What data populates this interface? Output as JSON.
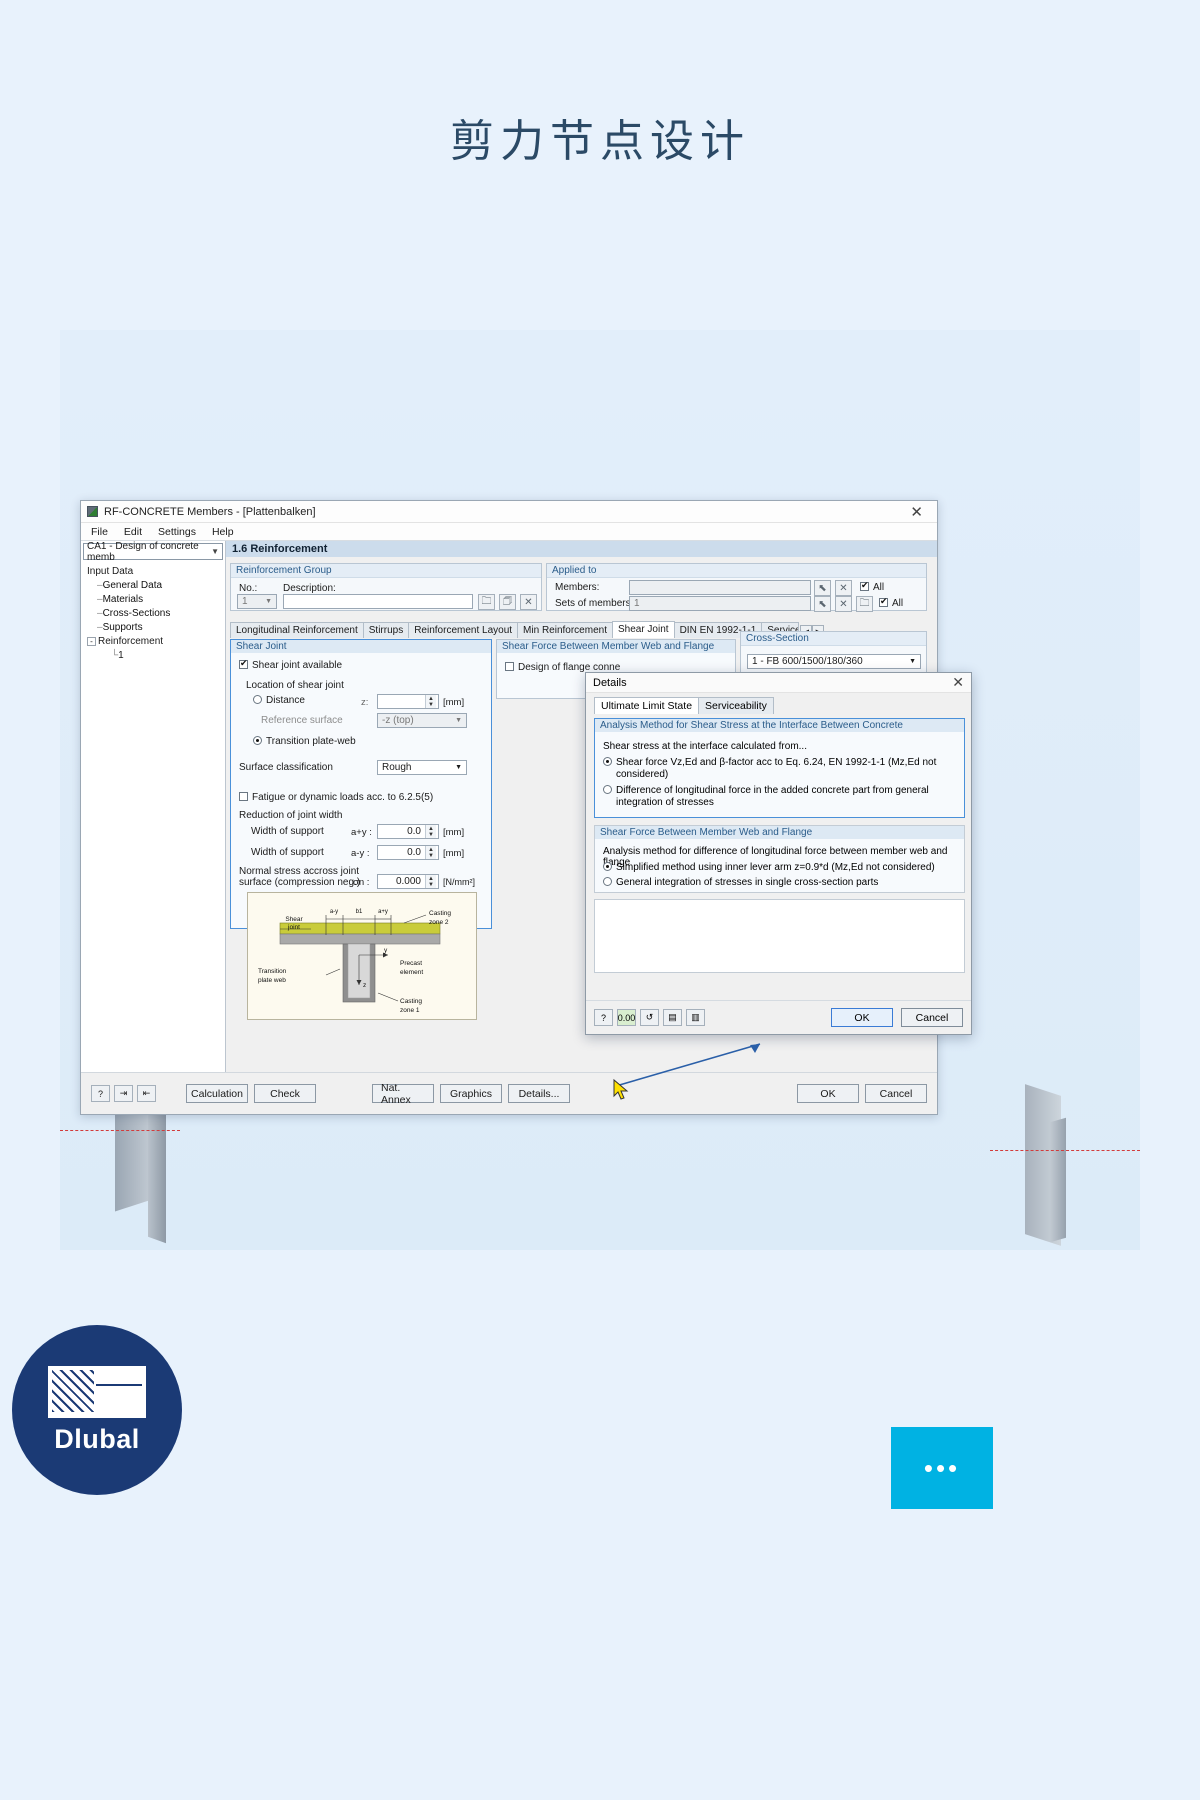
{
  "page": {
    "title": "剪力节点设计"
  },
  "window": {
    "title": "RF-CONCRETE Members - [Plattenbalken]",
    "close": "✕",
    "menu": [
      "File",
      "Edit",
      "Settings",
      "Help"
    ],
    "case_combo": "CA1 - Design of concrete memb",
    "tree": [
      {
        "label": "Input Data",
        "level": 1
      },
      {
        "label": "General Data",
        "level": 2
      },
      {
        "label": "Materials",
        "level": 2
      },
      {
        "label": "Cross-Sections",
        "level": 2
      },
      {
        "label": "Supports",
        "level": 2
      },
      {
        "label": "Reinforcement",
        "level": 2,
        "expander": "-"
      },
      {
        "label": "1",
        "level": 3
      }
    ],
    "section_header": "1.6 Reinforcement",
    "reinforcement_group": {
      "title": "Reinforcement Group",
      "no_label": "No.:",
      "no_value": "1",
      "description_label": "Description:",
      "description_value": ""
    },
    "applied_to": {
      "title": "Applied to",
      "members_label": "Members:",
      "members_value": "",
      "sets_label": "Sets of members:",
      "sets_value": "1",
      "all_label": "All"
    },
    "tabs": [
      {
        "label": "Longitudinal Reinforcement",
        "active": false
      },
      {
        "label": "Stirrups",
        "active": false
      },
      {
        "label": "Reinforcement Layout",
        "active": false
      },
      {
        "label": "Min Reinforcement",
        "active": false
      },
      {
        "label": "Shear Joint",
        "active": true
      },
      {
        "label": "DIN EN 1992-1-1",
        "active": false
      },
      {
        "label": "Service",
        "active": false
      }
    ],
    "tab_nav": {
      "prev": "◀",
      "next": "▶"
    },
    "shear_joint": {
      "title": "Shear Joint",
      "available_label": "Shear joint available",
      "available_checked": true,
      "location_label": "Location of shear joint",
      "distance_label": "Distance",
      "distance_selected": false,
      "z_label": "z:",
      "z_value": "",
      "z_unit": "[mm]",
      "reference_surface_label": "Reference surface",
      "reference_surface_value": "-z (top)",
      "transition_label": "Transition plate-web",
      "transition_selected": true,
      "surface_class_label": "Surface classification",
      "surface_class_value": "Rough",
      "fatigue_label": "Fatigue or dynamic loads acc. to 6.2.5(5)",
      "fatigue_checked": false,
      "reduction_label": "Reduction of joint width",
      "width_pos_label": "Width of support",
      "width_pos_symbol": "a+y :",
      "width_pos_value": "0.0",
      "width_pos_unit": "[mm]",
      "width_neg_label": "Width of support",
      "width_neg_symbol": "a-y :",
      "width_neg_value": "0.0",
      "width_neg_unit": "[mm]",
      "normal_stress_label_1": "Normal stress accross joint",
      "normal_stress_label_2": "surface (compression neg.)",
      "normal_stress_symbol": "σn :",
      "normal_stress_value": "0.000",
      "normal_stress_unit": "[N/mm²]",
      "diagram": {
        "shear": "Shear",
        "joint": "joint",
        "casting2_a": "Casting",
        "casting2_b": "zone 2",
        "transition_a": "Transition",
        "transition_b": "plate web",
        "precast_a": "Precast",
        "precast_b": "element",
        "casting1_a": "Casting",
        "casting1_b": "zone 1",
        "dim_ay": "a-y",
        "dim_b1": "b1",
        "dim_apy": "a+y",
        "axis_y": "y",
        "axis_z": "z"
      }
    },
    "shear_force_panel": {
      "title": "Shear Force Between Member Web and Flange",
      "flange_label": "Design of flange conne",
      "flange_checked": false
    },
    "cross_section": {
      "title": "Cross-Section",
      "value": "1 - FB 600/1500/180/360",
      "value2": "FB 600/1500/180/360"
    },
    "footer": {
      "calculation": "Calculation",
      "check": "Check",
      "nat_annex": "Nat. Annex",
      "graphics": "Graphics",
      "details": "Details...",
      "ok": "OK",
      "cancel": "Cancel"
    }
  },
  "details_dialog": {
    "title": "Details",
    "close": "✕",
    "tabs": [
      {
        "label": "Ultimate Limit State",
        "active": true
      },
      {
        "label": "Serviceability",
        "active": false
      }
    ],
    "analysis_method": {
      "title": "Analysis Method for Shear Stress at the Interface Between Concrete",
      "intro": "Shear stress at the interface calculated from...",
      "option1_a": "Shear force Vz,Ed and β-factor acc to Eq. 6.24, EN 1992-1-1 (Mz,Ed not",
      "option1_b": "considered)",
      "option1_selected": true,
      "option2_a": "Difference of longitudinal force in the added concrete part from general",
      "option2_b": "integration of stresses",
      "option2_selected": false
    },
    "web_flange": {
      "title": "Shear Force Between Member Web and Flange",
      "intro": "Analysis method for difference of longitudinal force between member web and flange",
      "option1": "Simplified method using inner lever arm z=0.9*d (Mz,Ed not considered)",
      "option1_selected": true,
      "option2": "General integration of stresses in single cross-section parts",
      "option2_selected": false
    },
    "footer": {
      "ok": "OK",
      "cancel": "Cancel"
    }
  },
  "branding": {
    "logo_text": "Dlubal",
    "dots": "•••"
  }
}
